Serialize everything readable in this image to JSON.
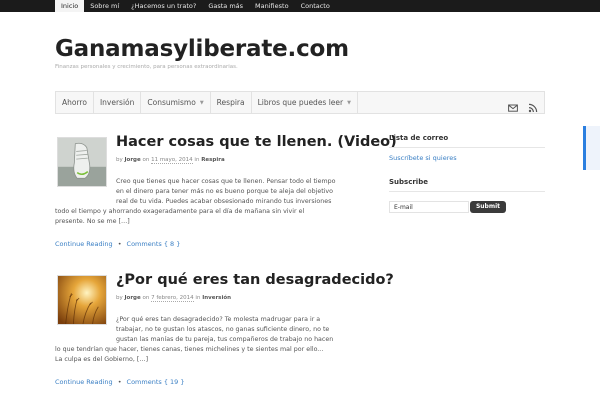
{
  "topnav": {
    "items": [
      "Inicio",
      "Sobre mí",
      "¿Hacemos un trato?",
      "Gasta más",
      "Manifiesto",
      "Contacto"
    ]
  },
  "site": {
    "title": "Ganamasyliberate.com",
    "tagline": "Finanzas personales y crecimiento, para personas extraordinarias."
  },
  "mainnav": {
    "items": [
      "Ahorro",
      "Inversión",
      "Consumismo",
      "Respira",
      "Libros que puedes leer"
    ],
    "icons": [
      "mail-icon",
      "rss-icon"
    ]
  },
  "posts": [
    {
      "title": "Hacer cosas que te llenen. (Video)",
      "meta": {
        "by": "by",
        "author": "Jorge",
        "on": "on",
        "date": "11 mayo, 2014",
        "in": "in",
        "category": "Respira"
      },
      "excerpt_lines": [
        "Creo que tienes que hacer cosas que te llenen. Pensar todo el tiempo",
        "en el dinero para tener más no es bueno porque te aleja del objetivo",
        "real de tu vida. Puedes acabar obsesionado mirando tus inversiones",
        "todo el tiempo y ahorrando exageradamente para el día de mañana sin vivir el",
        "presente.  No se me […]"
      ],
      "continue": "Continue Reading",
      "comments": "Comments { 8 }"
    },
    {
      "title": "¿Por qué eres tan desagradecido?",
      "meta": {
        "by": "by",
        "author": "Jorge",
        "on": "on",
        "date": "7 febrero, 2014",
        "in": "in",
        "category": "Inversión"
      },
      "excerpt_lines": [
        "¿Por qué eres tan desagradecido? Te molesta madrugar para ir a",
        "trabajar, no te gustan los atascos, no ganas suficiente dinero, no te",
        "gustan las manías de tu pareja, tus compañeros de trabajo no hacen",
        "lo que tendrían que hacer, tienes canas, tienes michelines y te sientes mal por ello...",
        "La culpa es del Gobierno, […]"
      ],
      "continue": "Continue Reading",
      "comments": "Comments { 19 }"
    }
  ],
  "sidebar": {
    "mailing": {
      "title": "Lista de correo",
      "link": "Suscríbete si quieres"
    },
    "subscribe": {
      "title": "Subscribe",
      "email_value": "E-mail",
      "submit": "Submit"
    }
  },
  "colors": {
    "link": "#3a7fc4",
    "topbar": "#1b1b1b",
    "badge": "#2b7fe0"
  }
}
